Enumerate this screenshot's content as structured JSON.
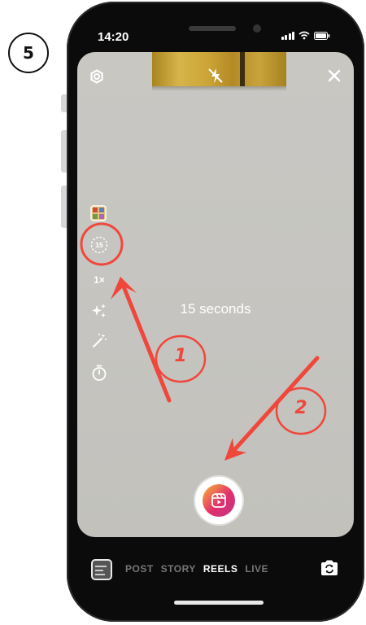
{
  "annotation": {
    "step_number": "5",
    "callout_1": "1",
    "callout_2": "2",
    "accent_color": "#f0473c"
  },
  "status_bar": {
    "time": "14:20",
    "icons": [
      "signal-icon",
      "wifi-icon",
      "battery-icon"
    ]
  },
  "camera": {
    "top_controls": [
      "settings-icon",
      "flash-off-icon",
      "close-icon"
    ],
    "left_rail": {
      "layout_icon": "layout-icon",
      "length_badge": "15",
      "speed": "1×",
      "effects_icon": "effects-sparkle-icon",
      "retouch_icon": "touch-up-wand-icon",
      "timer_icon": "timer-icon"
    },
    "duration_text": "15 seconds",
    "shutter_icon": "reels-icon"
  },
  "bottom_bar": {
    "modes": [
      "POST",
      "STORY",
      "REELS",
      "LIVE"
    ],
    "active_mode": "REELS",
    "gallery_icon": "gallery-thumbnail",
    "flip_icon": "flip-camera-icon"
  }
}
